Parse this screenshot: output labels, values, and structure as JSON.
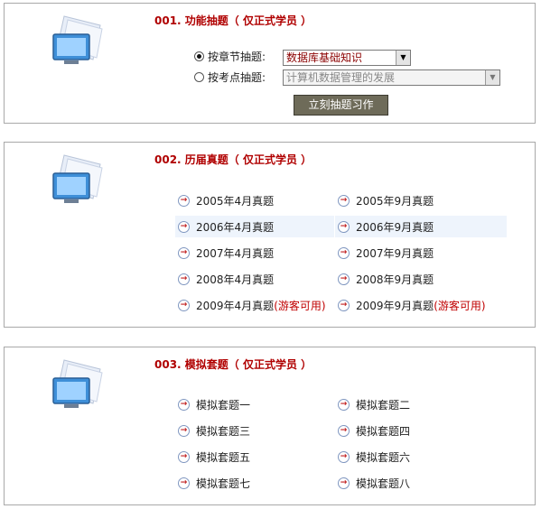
{
  "section1": {
    "title": "001. 功能抽题（ 仅正式学员 ）",
    "radio_chapter_label": "按章节抽题:",
    "radio_topic_label": "按考点抽题:",
    "chapter_selected": "数据库基础知识",
    "topic_selected": "计算机数据管理的发展",
    "button_label": "立刻抽题习作"
  },
  "section2": {
    "title": "002. 历届真题（ 仅正式学员 ）",
    "items": [
      {
        "label": "2005年4月真题",
        "note": ""
      },
      {
        "label": "2005年9月真题",
        "note": ""
      },
      {
        "label": "2006年4月真题",
        "note": ""
      },
      {
        "label": "2006年9月真题",
        "note": ""
      },
      {
        "label": "2007年4月真题",
        "note": ""
      },
      {
        "label": "2007年9月真题",
        "note": ""
      },
      {
        "label": "2008年4月真题",
        "note": ""
      },
      {
        "label": "2008年9月真题",
        "note": ""
      },
      {
        "label": "2009年4月真题",
        "note": "(游客可用)"
      },
      {
        "label": "2009年9月真题",
        "note": "(游客可用)"
      }
    ]
  },
  "section3": {
    "title": "003. 模拟套题（ 仅正式学员 ）",
    "items": [
      {
        "label": "模拟套题一"
      },
      {
        "label": "模拟套题二"
      },
      {
        "label": "模拟套题三"
      },
      {
        "label": "模拟套题四"
      },
      {
        "label": "模拟套题五"
      },
      {
        "label": "模拟套题六"
      },
      {
        "label": "模拟套题七"
      },
      {
        "label": "模拟套题八"
      }
    ]
  },
  "icons": {
    "section": "computer-monitor-icon",
    "link": "circle-arrow-right-icon"
  },
  "colors": {
    "title": "#b00000",
    "button": "#6e6b59",
    "guest_note": "#c00000",
    "row_highlight": "#eef4fc"
  }
}
